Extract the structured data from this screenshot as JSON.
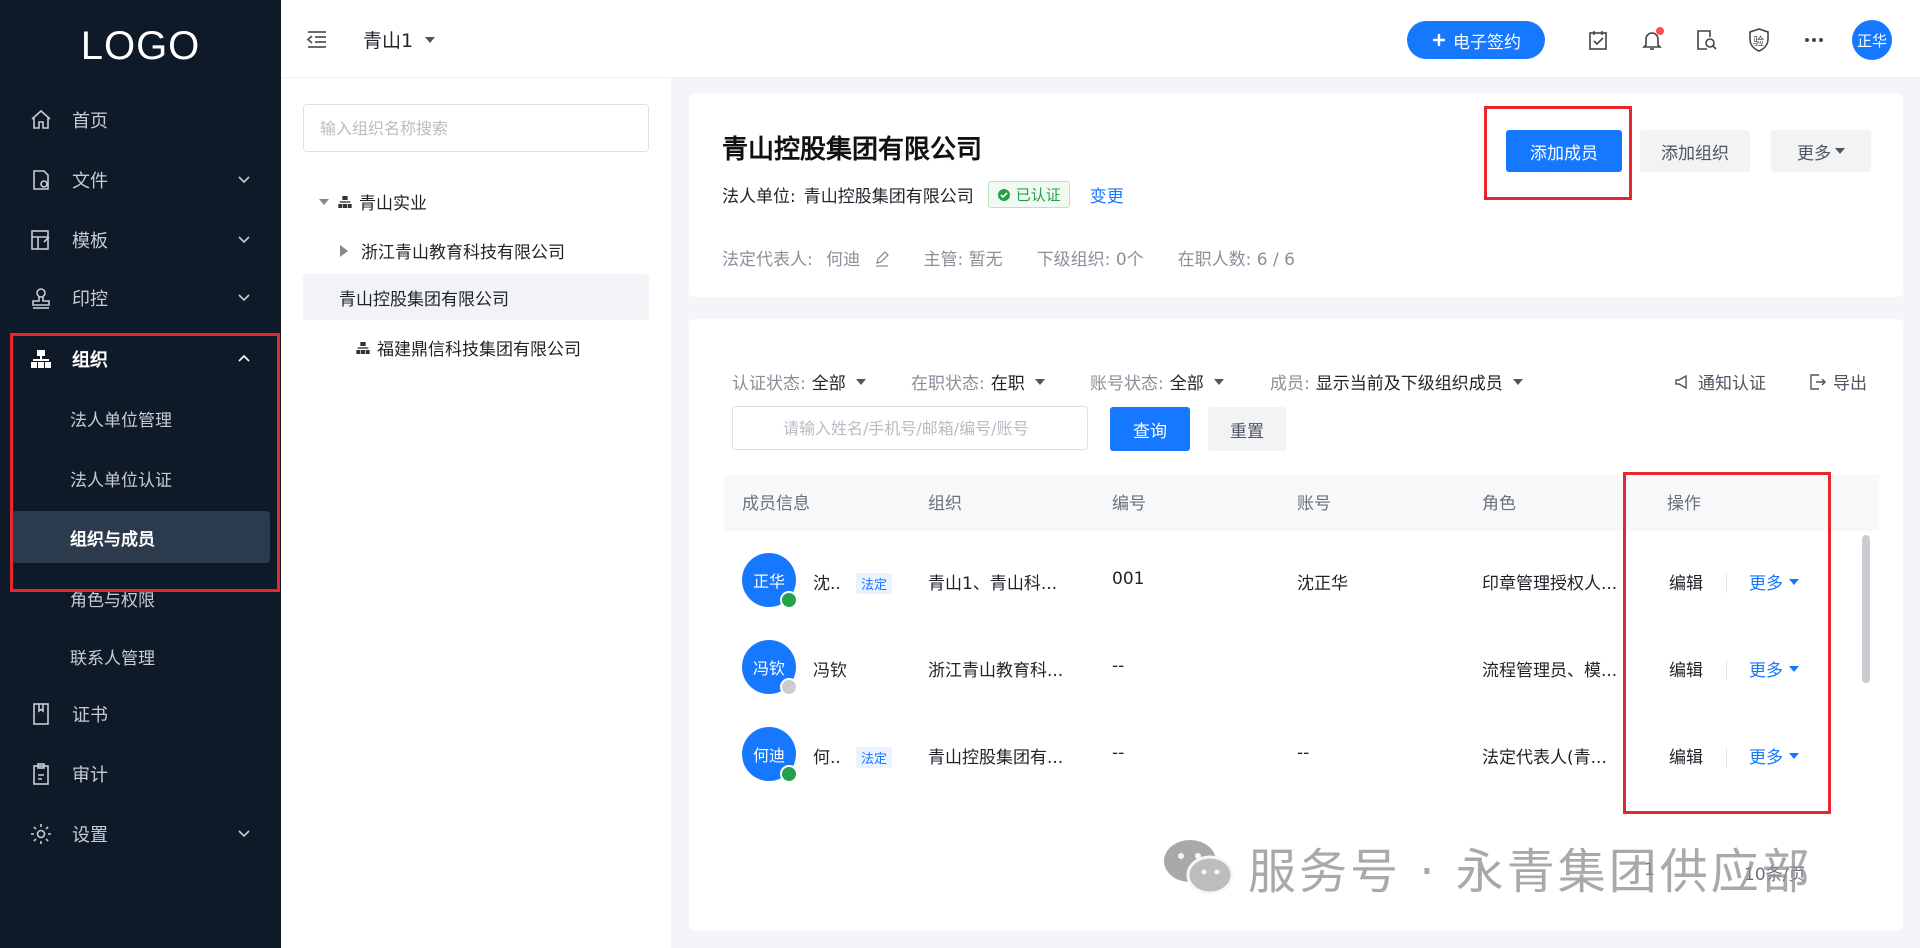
{
  "sidebar": {
    "logo": "LOGO",
    "items": [
      {
        "label": "首页"
      },
      {
        "label": "文件"
      },
      {
        "label": "模板"
      },
      {
        "label": "印控"
      },
      {
        "label": "组织"
      },
      {
        "label": "证书"
      },
      {
        "label": "审计"
      },
      {
        "label": "设置"
      }
    ],
    "org_sub": [
      {
        "label": "法人单位管理"
      },
      {
        "label": "法人单位认证"
      },
      {
        "label": "组织与成员"
      },
      {
        "label": "角色与权限"
      },
      {
        "label": "联系人管理"
      }
    ]
  },
  "topbar": {
    "org_name": "青山1",
    "esign_label": "电子签约",
    "user_initials": "正华",
    "verify_label": "验"
  },
  "tree": {
    "search_placeholder": "输入组织名称搜索",
    "root": "青山实业",
    "children": [
      "浙江青山教育科技有限公司",
      "青山控股集团有限公司"
    ],
    "other_root": "福建鼎信科技集团有限公司"
  },
  "company": {
    "name": "青山控股集团有限公司",
    "legal_label": "法人单位:",
    "legal_name": "青山控股集团有限公司",
    "verified": "已认证",
    "change": "变更",
    "rep_label": "法定代表人:",
    "rep_name": "何迪",
    "manager": "主管: 暂无",
    "sub_orgs": "下级组织: 0个",
    "staff": "在职人数: 6 / 6",
    "add_member": "添加成员",
    "add_org": "添加组织",
    "more": "更多"
  },
  "filters": {
    "auth_label": "认证状态:",
    "auth_value": "全部",
    "job_label": "在职状态:",
    "job_value": "在职",
    "acct_label": "账号状态:",
    "acct_value": "全部",
    "member_label": "成员:",
    "member_value": "显示当前及下级组织成员",
    "notify": "通知认证",
    "export": "导出",
    "search_placeholder": "请输入姓名/手机号/邮箱/编号/账号",
    "query": "查询",
    "reset": "重置"
  },
  "table": {
    "headers": [
      "成员信息",
      "组织",
      "编号",
      "账号",
      "角色",
      "操作"
    ],
    "rows": [
      {
        "avatar": "正华",
        "name": "沈..",
        "tag": "法定",
        "org": "青山1、青山科...",
        "code": "001",
        "account": "沈正华",
        "role": "印章管理授权人...",
        "edit": "编辑",
        "more": "更多"
      },
      {
        "avatar": "冯钦",
        "name": "冯钦",
        "tag": "",
        "org": "浙江青山教育科...",
        "code": "--",
        "account": "",
        "role": "流程管理员、模...",
        "edit": "编辑",
        "more": "更多"
      },
      {
        "avatar": "何迪",
        "name": "何..",
        "tag": "法定",
        "org": "青山控股集团有...",
        "code": "--",
        "account": "--",
        "role": "法定代表人(青...",
        "edit": "编辑",
        "more": "更多"
      }
    ]
  },
  "pager": {
    "page": "1",
    "page_size": "10条/页"
  },
  "watermark": "服务号 · 永青集团供应部",
  "colors": {
    "primary": "#1677ff",
    "sidebar_bg": "#0f1a28",
    "highlight": "#e8262d",
    "success": "#25a14a"
  }
}
